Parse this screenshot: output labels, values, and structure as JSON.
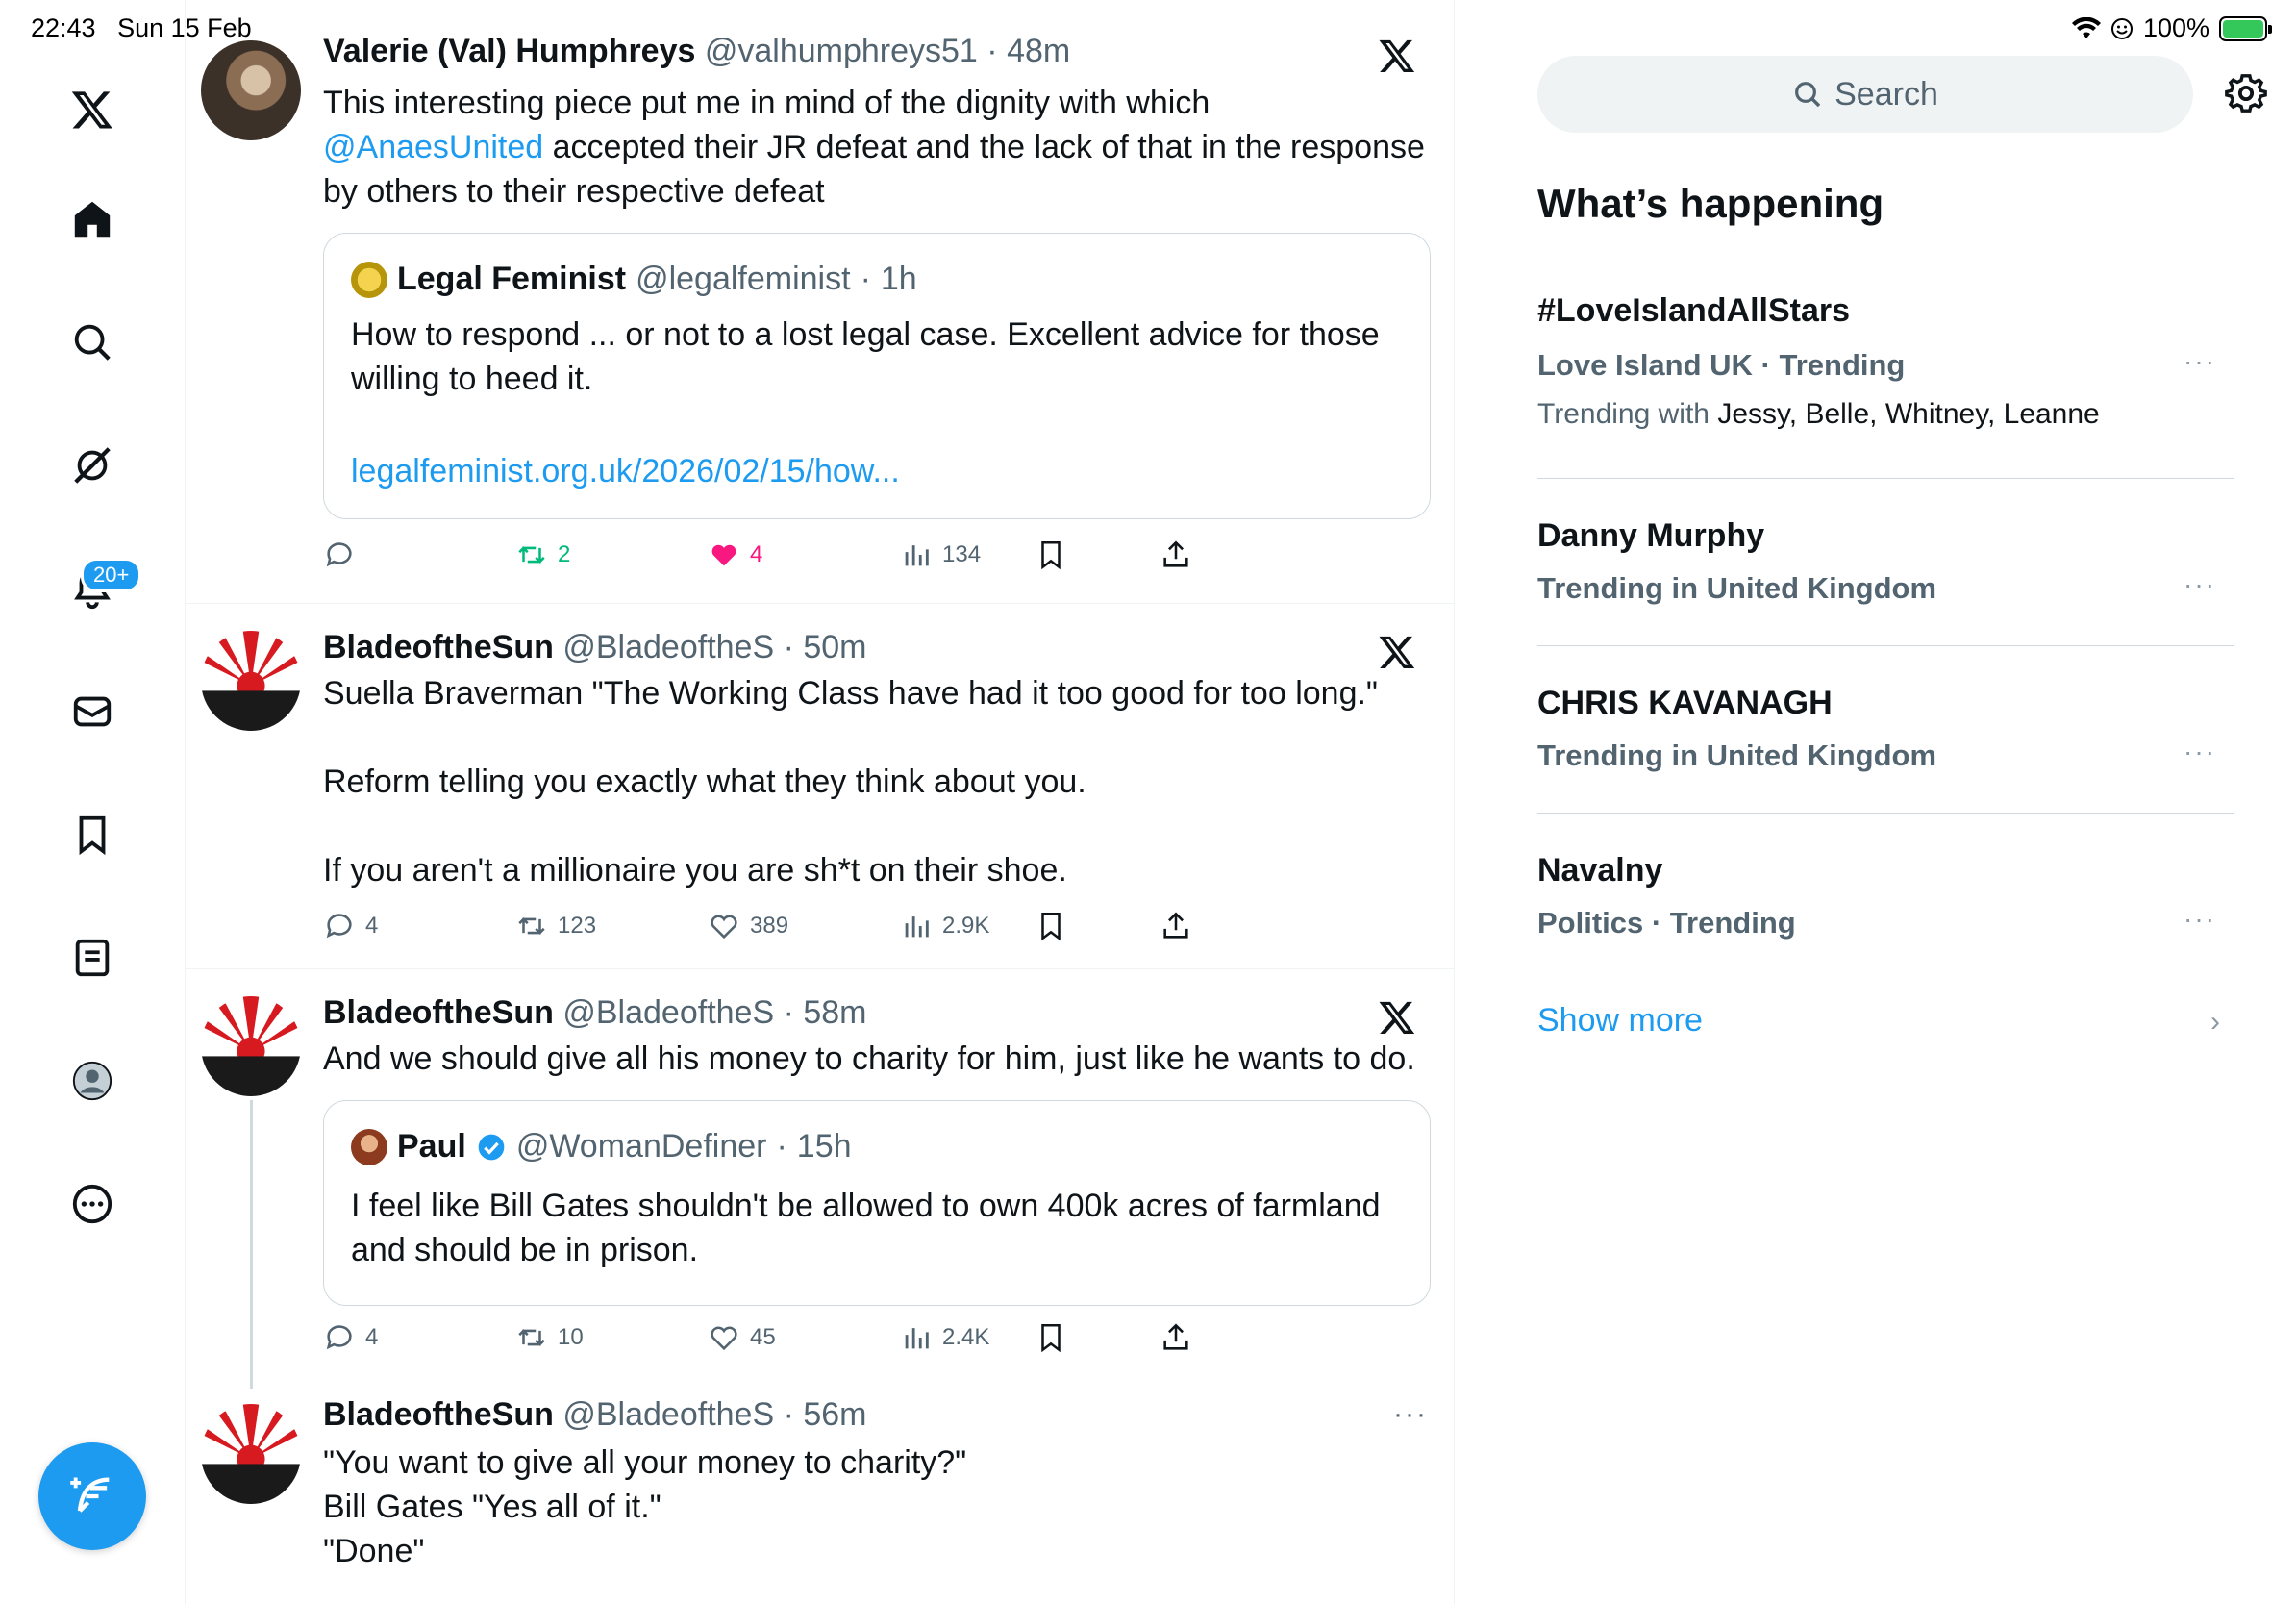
{
  "status": {
    "time": "22:43",
    "date": "Sun 15 Feb",
    "battery": "100%"
  },
  "nav": {
    "notifications_badge": "20+",
    "items": [
      "x-logo",
      "home-icon",
      "explore-icon",
      "grok-icon",
      "notifications-icon",
      "messages-icon",
      "bookmarks-icon",
      "lists-icon",
      "profile-icon",
      "more-icon"
    ]
  },
  "posts": [
    {
      "name": "Valerie (Val) Humphreys",
      "handle": "@valhumphreys51",
      "time": "48m",
      "text_before": "This interesting piece put me in mind of the dignity with which ",
      "mention": "@AnaesUnited",
      "text_after": " accepted their JR defeat and the lack of that in the response by others to their respective defeat",
      "quote": {
        "name": "Legal Feminist",
        "handle": "@legalfeminist",
        "time": "1h",
        "text": "How to respond ... or not to a lost legal case. Excellent advice for those willing to heed it.",
        "link": "legalfeminist.org.uk/2026/02/15/how..."
      },
      "replies": "",
      "reposts": "2",
      "likes": "4",
      "views": "134"
    },
    {
      "name": "BladeoftheSun",
      "handle": "@BladeoftheS",
      "time": "50m",
      "line1": "Suella Braverman \"The Working Class have had it too good for too long.\"",
      "line2": "Reform telling you exactly what they think about you.",
      "line3": "If you aren't a millionaire you are sh*t on their shoe.",
      "replies": "4",
      "reposts": "123",
      "likes": "389",
      "views": "2.9K"
    },
    {
      "name": "BladeoftheSun",
      "handle": "@BladeoftheS",
      "time": "58m",
      "text": "And we should give all his money to charity for him, just like he wants to do.",
      "quote": {
        "name": "Paul",
        "handle": "@WomanDefiner",
        "time": "15h",
        "text": "I feel like Bill Gates shouldn't be allowed to own 400k acres of farmland and should be in prison."
      },
      "replies": "4",
      "reposts": "10",
      "likes": "45",
      "views": "2.4K"
    },
    {
      "name": "BladeoftheSun",
      "handle": "@BladeoftheS",
      "time": "56m",
      "line1": "\"You want to give all your money to charity?\"",
      "line2": "Bill Gates \"Yes all of it.\"",
      "line3": "\"Done\""
    }
  ],
  "sidebar": {
    "search_placeholder": "Search",
    "title": "What’s happening",
    "trends": [
      {
        "name": "#LoveIslandAllStars",
        "context": "Love Island UK · Trending",
        "with_label": "Trending with ",
        "with_names": "Jessy, Belle, Whitney, Leanne"
      },
      {
        "name": "Danny Murphy",
        "context": "Trending in United Kingdom"
      },
      {
        "name": "CHRIS KAVANAGH",
        "context": "Trending in United Kingdom"
      },
      {
        "name": "Navalny",
        "context": "Politics · Trending"
      }
    ],
    "show_more": "Show more"
  },
  "colors": {
    "accent": "#1d9bf0",
    "repost": "#00ba7c",
    "like": "#f91880",
    "secondary_text": "#536471"
  }
}
